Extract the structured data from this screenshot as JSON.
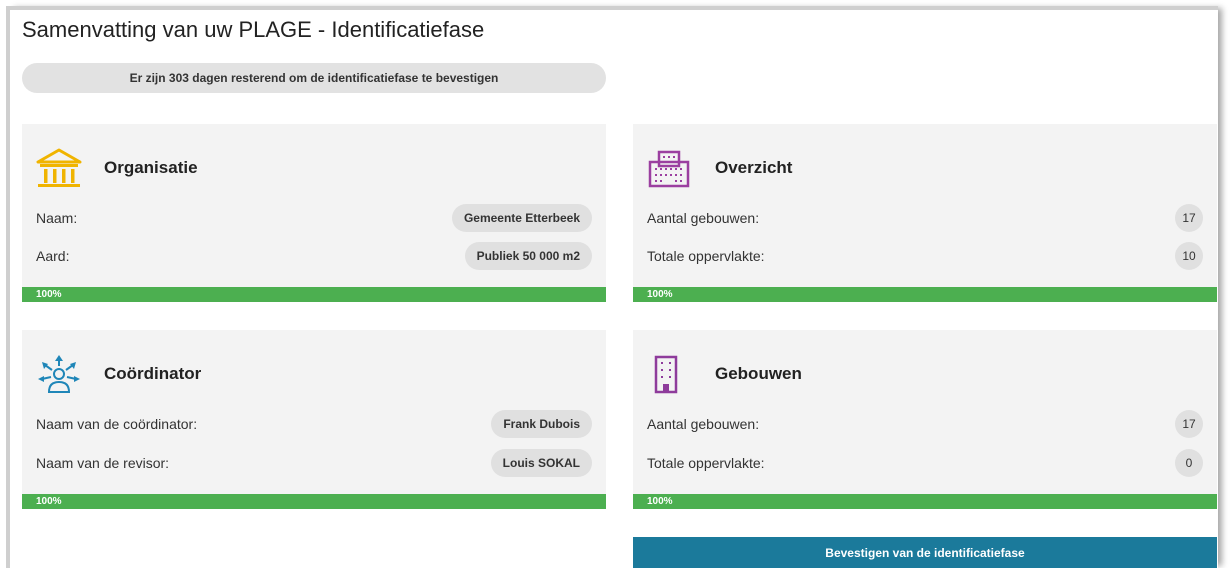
{
  "page": {
    "title": "Samenvatting van uw PLAGE - Identificatiefase",
    "countdown": "Er zijn 303 dagen resterend om de identificatiefase te bevestigen"
  },
  "organisatie": {
    "title": "Organisatie",
    "icon": "building-columns-icon",
    "rows": [
      {
        "label": "Naam:",
        "value": "Gemeente Etterbeek"
      },
      {
        "label": "Aard:",
        "value": "Publiek 50 000 m2"
      }
    ],
    "progress": 100,
    "progress_label": "100%"
  },
  "overzicht": {
    "title": "Overzicht",
    "icon": "office-buildings-icon",
    "rows": [
      {
        "label": "Aantal gebouwen:",
        "value": "17"
      },
      {
        "label": "Totale oppervlakte:",
        "value": "10"
      }
    ],
    "progress": 100,
    "progress_label": "100%"
  },
  "coordinator": {
    "title": "Coördinator",
    "icon": "network-person-icon",
    "rows": [
      {
        "label": "Naam van de coördinator:",
        "value": "Frank Dubois"
      },
      {
        "label": "Naam van de revisor:",
        "value": "Louis SOKAL"
      }
    ],
    "progress": 100,
    "progress_label": "100%"
  },
  "gebouwen": {
    "title": "Gebouwen",
    "icon": "building-icon",
    "rows": [
      {
        "label": "Aantal gebouwen:",
        "value": "17"
      },
      {
        "label": "Totale oppervlakte:",
        "value": "0"
      }
    ],
    "progress": 100,
    "progress_label": "100%"
  },
  "actions": {
    "confirm_label": "Bevestigen van de identificatiefase"
  },
  "colors": {
    "organisatie_icon": "#f0b400",
    "overzicht_icon": "#9b3fa0",
    "coordinator_icon": "#1f86b8",
    "gebouwen_icon": "#8e3b9b",
    "progress": "#4caf50",
    "button": "#1b7a9b"
  }
}
